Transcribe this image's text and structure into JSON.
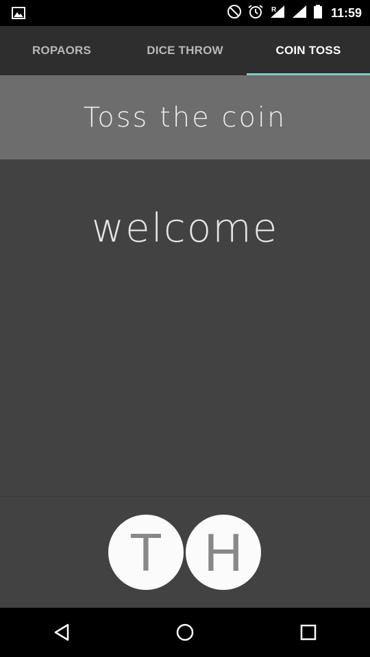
{
  "status_bar": {
    "time": "11:59",
    "icons": [
      "image-icon",
      "do-not-disturb-icon",
      "alarm-icon",
      "signal-roaming-icon",
      "signal-icon",
      "battery-icon"
    ]
  },
  "tabs": [
    {
      "label": "ROPAORS",
      "active": false
    },
    {
      "label": "DICE THROW",
      "active": false
    },
    {
      "label": "COIN TOSS",
      "active": true
    }
  ],
  "header": {
    "title": "Toss the coin"
  },
  "main": {
    "message": "welcome"
  },
  "coins": [
    {
      "label": "T"
    },
    {
      "label": "H"
    }
  ],
  "nav_bar": {
    "icons": [
      "back-icon",
      "home-icon",
      "recents-icon"
    ]
  },
  "colors": {
    "accent": "#80cbc4",
    "tab_bar_bg": "#2e2e2e",
    "header_bg": "#6d6d6d",
    "main_bg": "#424242"
  }
}
